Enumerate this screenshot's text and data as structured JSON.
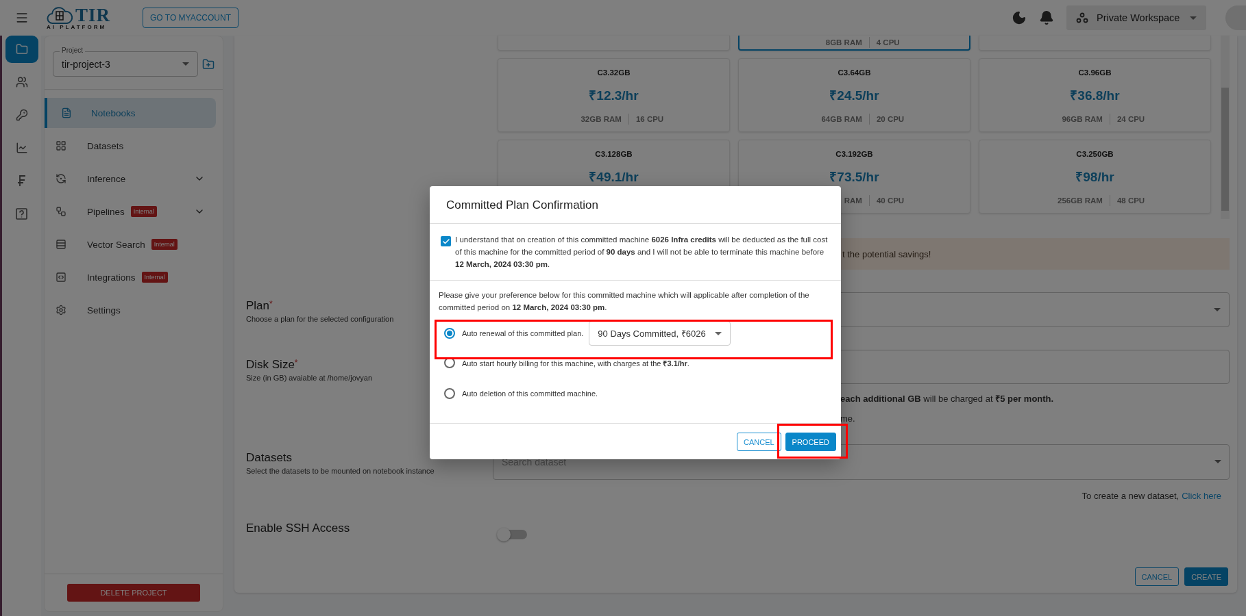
{
  "topbar": {
    "logo": {
      "name": "TIR",
      "tagline": "AI PLATFORM"
    },
    "account_button": "GO TO MYACCOUNT",
    "workspace": "Private Workspace"
  },
  "rail": [
    {
      "selected": true
    },
    {
      "selected": false
    },
    {
      "selected": false
    },
    {
      "selected": false
    },
    {
      "selected": false
    },
    {
      "selected": false
    }
  ],
  "project": {
    "label": "Project",
    "value": "tir-project-3"
  },
  "nav": [
    {
      "label": "Notebooks",
      "selected": true,
      "expandable": false
    },
    {
      "label": "Datasets",
      "selected": false,
      "expandable": false
    },
    {
      "label": "Inference",
      "selected": false,
      "expandable": true
    },
    {
      "label": "Pipelines",
      "selected": false,
      "expandable": true,
      "badge": "Internal"
    },
    {
      "label": "Vector Search",
      "selected": false,
      "expandable": false,
      "badge": "Internal"
    },
    {
      "label": "Integrations",
      "selected": false,
      "expandable": false,
      "badge": "Internal"
    },
    {
      "label": "Settings",
      "selected": false,
      "expandable": false
    }
  ],
  "delete_button": "DELETE PROJECT",
  "partial_cards": [
    {
      "selected": false
    },
    {
      "selected": true,
      "ram": "8GB RAM",
      "cpu": "4 CPU"
    },
    {
      "selected": false
    }
  ],
  "plan_cards": [
    {
      "name": "C3.32GB",
      "price": "₹12.3/hr",
      "ram": "32GB RAM",
      "cpu": "16 CPU",
      "selected": false
    },
    {
      "name": "C3.64GB",
      "price": "₹24.5/hr",
      "ram": "64GB RAM",
      "cpu": "20 CPU",
      "selected": false
    },
    {
      "name": "C3.96GB",
      "price": "₹36.8/hr",
      "ram": "96GB RAM",
      "cpu": "24 CPU",
      "selected": false
    },
    {
      "name": "C3.128GB",
      "price": "₹49.1/hr",
      "selected": false
    },
    {
      "name": "C3.192GB",
      "price": "₹73.5/hr",
      "ram": "RAM",
      "cpu": "40 CPU",
      "selected": false
    },
    {
      "name": "C3.250GB",
      "price": "₹98/hr",
      "ram": "256GB RAM",
      "cpu": "48 CPU",
      "selected": false
    }
  ],
  "banner": {
    "text": "t the potential savings!"
  },
  "form": {
    "plan": {
      "label": "Plan",
      "required_mark": "*",
      "hint": "Choose a plan for the selected configuration"
    },
    "disk": {
      "label": "Disk Size",
      "required_mark": "*",
      "hint": "Size (in GB) avaiable at /home/jovyan",
      "note": "**each additional GB** will be charged at **₹5 per month.**",
      "note_2": "me."
    },
    "datasets": {
      "label": "Datasets",
      "hint": "Select the datasets to be mounted on notebook instance",
      "placeholder": "Search dataset",
      "create_text": "To create a new dataset,",
      "create_link": "Click here"
    },
    "ssh": {
      "label": "Enable SSH Access",
      "on": false
    },
    "buttons": {
      "cancel": "CANCEL",
      "create": "CREATE"
    }
  },
  "dialog": {
    "title": "Committed Plan Confirmation",
    "checked": true,
    "agreement": "I understand that on creation of this committed machine **6026 Infra credits** will be deducted as the full cost of this machine for the committed period of **90 days** and I will not be able to terminate this machine before **12 March, 2024 03:30 pm**.",
    "preference": "Please give your preference below for this committed machine which will applicable after completion of the committed period on **12 March, 2024 03:30 pm**.",
    "options": [
      {
        "label": "Auto renewal of this committed plan.",
        "selected": true,
        "select_value": "90 Days Committed, ₹6026"
      },
      {
        "label": "Auto start hourly billing for this machine, with charges at the **₹3.1/hr**.",
        "selected": false
      },
      {
        "label": "Auto deletion of this committed machine.",
        "selected": false
      }
    ],
    "cancel": "CANCEL",
    "proceed": "PROCEED"
  }
}
